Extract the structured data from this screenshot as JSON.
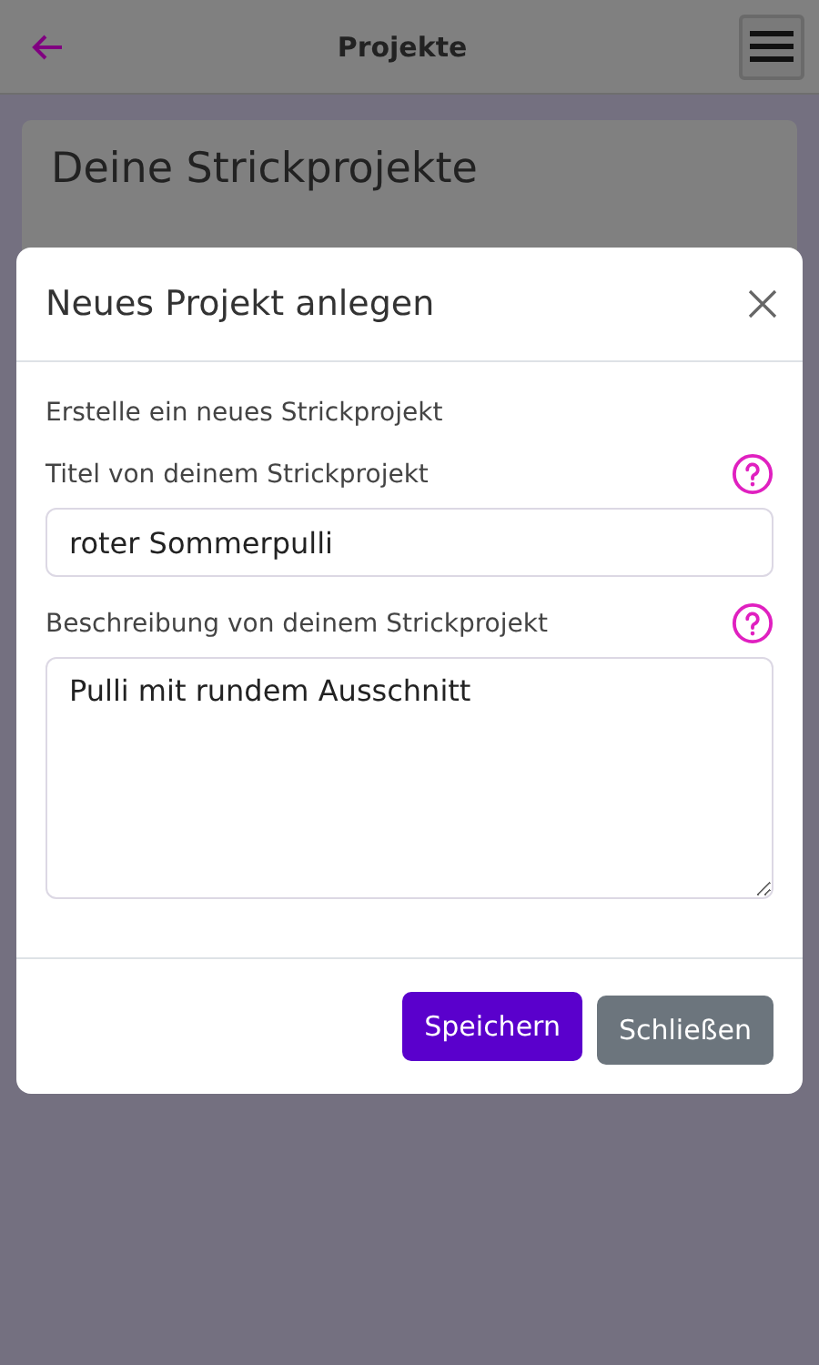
{
  "app_bar": {
    "title": "Projekte"
  },
  "page": {
    "heading": "Deine Strickprojekte"
  },
  "dialog": {
    "title": "Neues Projekt anlegen",
    "intro": "Erstelle ein neues Strickprojekt",
    "fields": [
      {
        "kind": "input",
        "label": "Titel von deinem Strickprojekt",
        "value": "roter Sommerpulli"
      },
      {
        "kind": "textarea",
        "label": "Beschreibung von deinem Strickprojekt",
        "value": "Pulli mit rundem Ausschnitt"
      }
    ],
    "buttons": [
      {
        "kind": "primary",
        "label": "Speichern"
      },
      {
        "kind": "secondary",
        "label": "Schließen"
      }
    ]
  }
}
